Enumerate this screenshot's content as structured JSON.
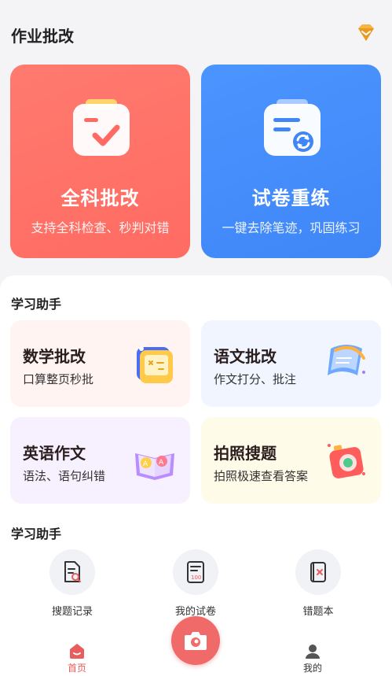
{
  "header": {
    "title": "作业批改",
    "vip_icon": "diamond-icon"
  },
  "main_cards": [
    {
      "label": "全科批改",
      "sub": "支持全科检查、秒判对错",
      "icon": "check-paper-icon",
      "color": "#ff6f66"
    },
    {
      "label": "试卷重练",
      "sub": "一键去除笔迹，巩固练习",
      "icon": "refresh-paper-icon",
      "color": "#4289fa"
    }
  ],
  "assistant": {
    "title": "学习助手",
    "tools": [
      {
        "label": "数学批改",
        "sub": "口算整页秒批",
        "icon": "calculator-icon"
      },
      {
        "label": "语文批改",
        "sub": "作文打分、批注",
        "icon": "scroll-icon"
      },
      {
        "label": "英语作文",
        "sub": "语法、语句纠错",
        "icon": "open-book-icon"
      },
      {
        "label": "拍照搜题",
        "sub": "拍照极速查看答案",
        "icon": "camera-search-icon"
      }
    ]
  },
  "assistant2": {
    "title": "学习助手",
    "items": [
      {
        "label": "搜题记录",
        "icon": "search-record-icon"
      },
      {
        "label": "我的试卷",
        "icon": "exam-paper-icon"
      },
      {
        "label": "错题本",
        "icon": "wrong-book-icon"
      }
    ]
  },
  "tabbar": {
    "home": "首页",
    "mine": "我的",
    "active_color": "#e85d5d"
  }
}
